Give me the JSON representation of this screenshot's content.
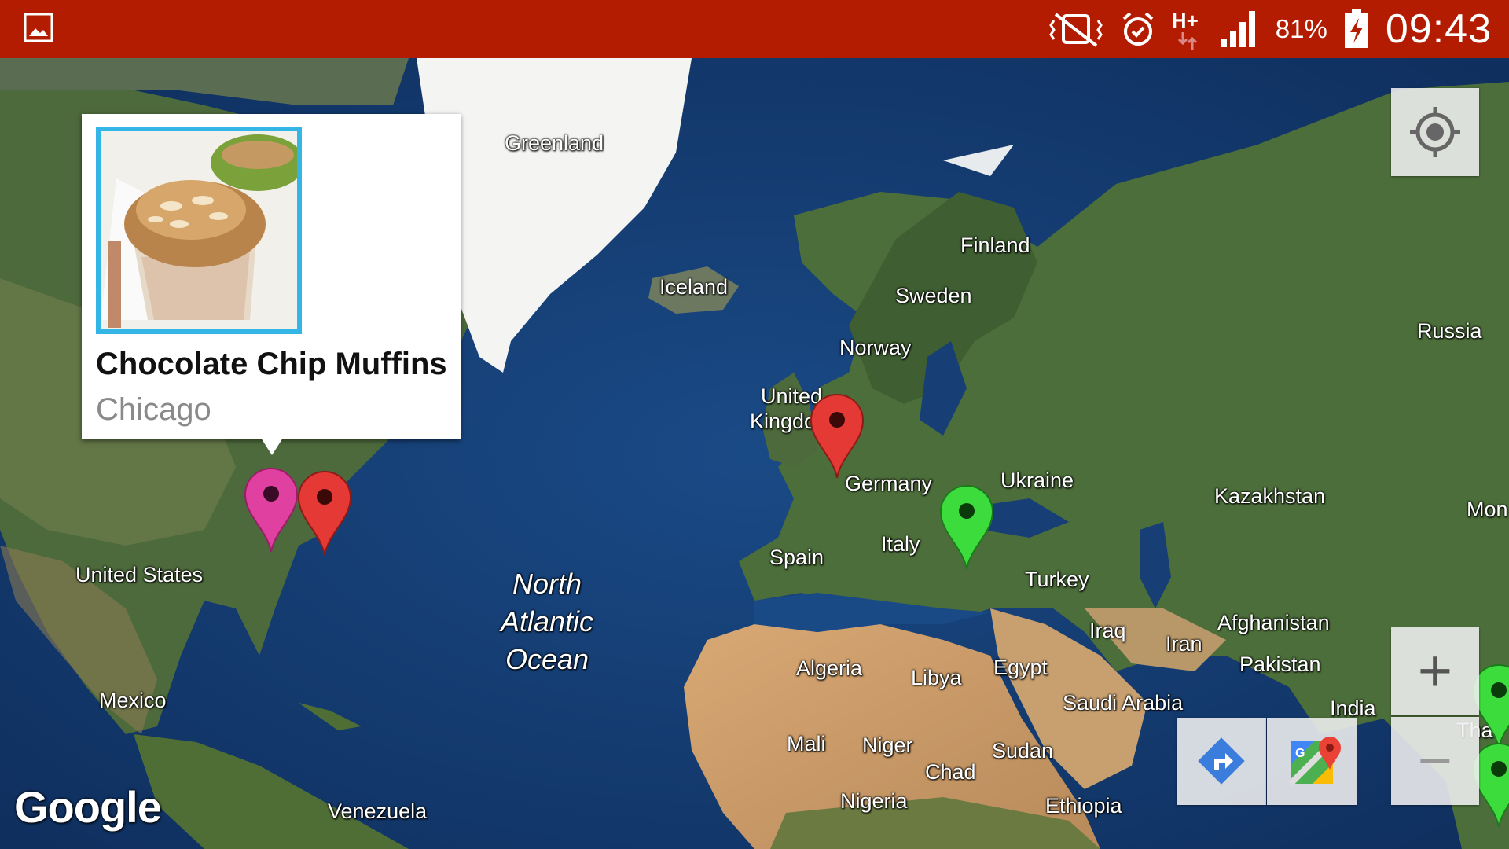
{
  "status_bar": {
    "battery_percent": "81%",
    "clock": "09:43",
    "network_type": "H+",
    "icons": [
      "image-notification-icon",
      "vibrate-mute-icon",
      "alarm-icon",
      "network-hplus-icon",
      "signal-icon",
      "battery-charging-icon"
    ]
  },
  "info_window": {
    "title": "Chocolate Chip Muffins",
    "subtitle": "Chicago"
  },
  "map_labels": {
    "greenland": "Greenland",
    "iceland": "Iceland",
    "finland": "Finland",
    "sweden": "Sweden",
    "norway": "Norway",
    "russia": "Russia",
    "uk_line1": "United",
    "uk_line2": "Kingdom",
    "germany": "Germany",
    "ukraine": "Ukraine",
    "kazakhstan": "Kazakhstan",
    "mongolia": "Mon",
    "spain": "Spain",
    "italy": "Italy",
    "turkey": "Turkey",
    "iraq": "Iraq",
    "iran": "Iran",
    "afghanistan": "Afghanistan",
    "pakistan": "Pakistan",
    "india": "India",
    "thailand": "Tha",
    "algeria": "Algeria",
    "libya": "Libya",
    "egypt": "Egypt",
    "saudi_arabia": "Saudi Arabia",
    "mali": "Mali",
    "niger": "Niger",
    "chad": "Chad",
    "sudan": "Sudan",
    "nigeria": "Nigeria",
    "ethiopia": "Ethiopia",
    "united_states": "United States",
    "mexico": "Mexico",
    "venezuela": "Venezuela",
    "ocean_line1": "North",
    "ocean_line2": "Atlantic",
    "ocean_line3": "Ocean"
  },
  "markers": [
    {
      "name": "chicago",
      "color": "#e040a0"
    },
    {
      "name": "east-us",
      "color": "#e53935"
    },
    {
      "name": "london",
      "color": "#e53935"
    },
    {
      "name": "balkans",
      "color": "#3ddc3d"
    },
    {
      "name": "asia-1",
      "color": "#3ddc3d"
    },
    {
      "name": "asia-2",
      "color": "#3ddc3d"
    }
  ],
  "controls": {
    "my_location_icon": "my-location-icon",
    "zoom_in": "+",
    "zoom_out": "−",
    "directions_icon": "directions-icon",
    "open_maps_icon": "google-maps-icon"
  },
  "attribution": "Google",
  "colors": {
    "status_bar": "#b31c00",
    "info_border": "#33b5e5",
    "ocean": "#123a6e"
  }
}
